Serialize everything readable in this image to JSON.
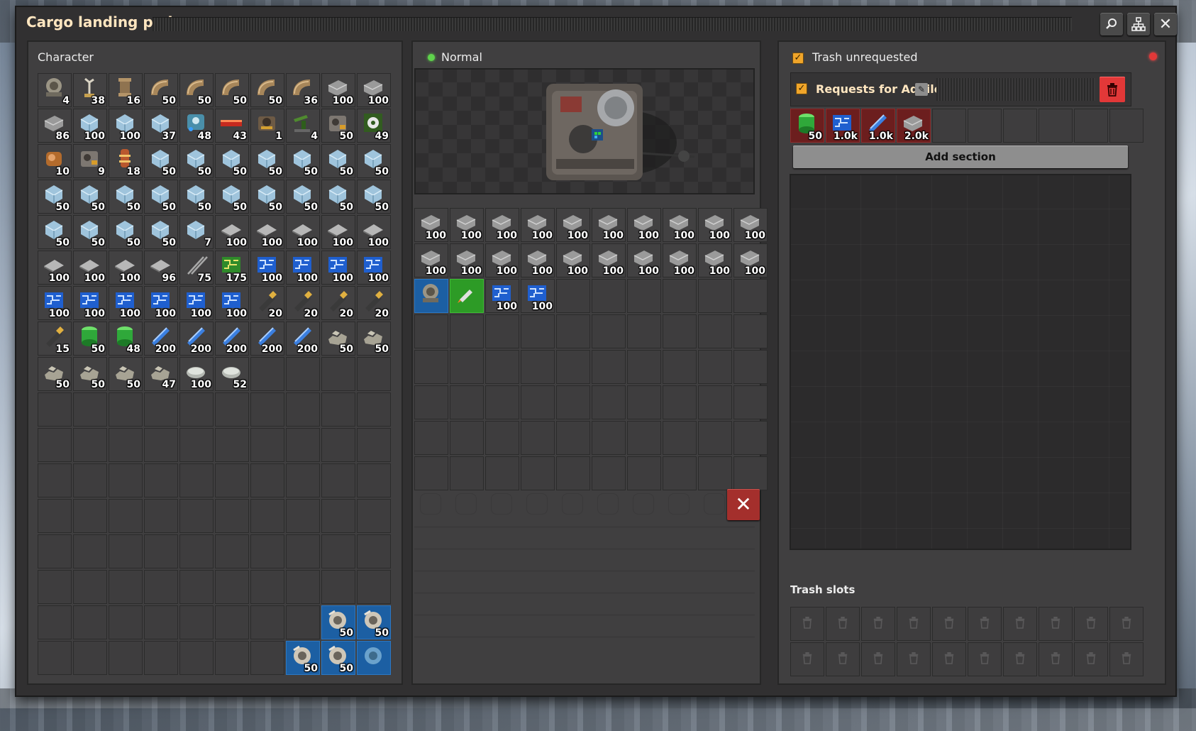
{
  "window": {
    "title": "Cargo landing pad"
  },
  "character": {
    "title": "Character",
    "slots": [
      {
        "icon": "gear-engine-icon",
        "count": "4"
      },
      {
        "icon": "inserter-icon",
        "count": "38"
      },
      {
        "icon": "pipe-icon",
        "count": "16"
      },
      {
        "icon": "pipe-elbow-icon",
        "count": "50"
      },
      {
        "icon": "pipe-elbow-icon",
        "count": "50"
      },
      {
        "icon": "pipe-elbow-icon",
        "count": "50"
      },
      {
        "icon": "pipe-elbow-icon",
        "count": "50"
      },
      {
        "icon": "pipe-elbow-icon",
        "count": "36"
      },
      {
        "icon": "steel-plate-icon",
        "count": "100"
      },
      {
        "icon": "steel-plate-icon",
        "count": "100"
      },
      {
        "icon": "steel-plate-icon",
        "count": "86"
      },
      {
        "icon": "ice-icon",
        "count": "100"
      },
      {
        "icon": "ice-icon",
        "count": "100"
      },
      {
        "icon": "ice-icon",
        "count": "37"
      },
      {
        "icon": "lab-module-icon",
        "count": "48"
      },
      {
        "icon": "red-bar-icon",
        "count": "43"
      },
      {
        "icon": "assembler-icon",
        "count": "1"
      },
      {
        "icon": "pumpjack-icon",
        "count": "4"
      },
      {
        "icon": "machine-icon",
        "count": "50"
      },
      {
        "icon": "circuit-gear-icon",
        "count": "49"
      },
      {
        "icon": "copper-machine-icon",
        "count": "10"
      },
      {
        "icon": "machine-icon",
        "count": "9"
      },
      {
        "icon": "tower-icon",
        "count": "18"
      },
      {
        "icon": "ice-icon",
        "count": "50"
      },
      {
        "icon": "ice-icon",
        "count": "50"
      },
      {
        "icon": "ice-icon",
        "count": "50"
      },
      {
        "icon": "ice-icon",
        "count": "50"
      },
      {
        "icon": "ice-icon",
        "count": "50"
      },
      {
        "icon": "ice-icon",
        "count": "50"
      },
      {
        "icon": "ice-icon",
        "count": "50"
      },
      {
        "icon": "ice-icon",
        "count": "50"
      },
      {
        "icon": "ice-icon",
        "count": "50"
      },
      {
        "icon": "ice-icon",
        "count": "50"
      },
      {
        "icon": "ice-icon",
        "count": "50"
      },
      {
        "icon": "ice-icon",
        "count": "50"
      },
      {
        "icon": "ice-icon",
        "count": "50"
      },
      {
        "icon": "ice-icon",
        "count": "50"
      },
      {
        "icon": "ice-icon",
        "count": "50"
      },
      {
        "icon": "ice-icon",
        "count": "50"
      },
      {
        "icon": "ice-icon",
        "count": "50"
      },
      {
        "icon": "ice-icon",
        "count": "50"
      },
      {
        "icon": "ice-icon",
        "count": "50"
      },
      {
        "icon": "ice-icon",
        "count": "50"
      },
      {
        "icon": "ice-icon",
        "count": "50"
      },
      {
        "icon": "ice-icon",
        "count": "7"
      },
      {
        "icon": "plate-icon",
        "count": "100"
      },
      {
        "icon": "plate-icon",
        "count": "100"
      },
      {
        "icon": "plate-icon",
        "count": "100"
      },
      {
        "icon": "plate-icon",
        "count": "100"
      },
      {
        "icon": "plate-icon",
        "count": "100"
      },
      {
        "icon": "plate-icon",
        "count": "100"
      },
      {
        "icon": "plate-icon",
        "count": "100"
      },
      {
        "icon": "plate-icon",
        "count": "100"
      },
      {
        "icon": "plate-icon",
        "count": "96"
      },
      {
        "icon": "rail-icon",
        "count": "75"
      },
      {
        "icon": "green-circuit-icon",
        "count": "175"
      },
      {
        "icon": "blue-circuit-icon",
        "count": "100"
      },
      {
        "icon": "blue-circuit-icon",
        "count": "100"
      },
      {
        "icon": "blue-circuit-icon",
        "count": "100"
      },
      {
        "icon": "blue-circuit-icon",
        "count": "100"
      },
      {
        "icon": "blue-circuit-icon",
        "count": "100"
      },
      {
        "icon": "blue-circuit-icon",
        "count": "100"
      },
      {
        "icon": "blue-circuit-icon",
        "count": "100"
      },
      {
        "icon": "blue-circuit-icon",
        "count": "100"
      },
      {
        "icon": "blue-circuit-icon",
        "count": "100"
      },
      {
        "icon": "blue-circuit-icon",
        "count": "100"
      },
      {
        "icon": "cell-icon",
        "count": "20"
      },
      {
        "icon": "cell-icon",
        "count": "20"
      },
      {
        "icon": "cell-icon",
        "count": "20"
      },
      {
        "icon": "cell-icon",
        "count": "20"
      },
      {
        "icon": "cell-icon",
        "count": "15"
      },
      {
        "icon": "green-barrel-icon",
        "count": "50"
      },
      {
        "icon": "green-barrel-icon",
        "count": "48"
      },
      {
        "icon": "blue-rod-icon",
        "count": "200"
      },
      {
        "icon": "blue-rod-icon",
        "count": "200"
      },
      {
        "icon": "blue-rod-icon",
        "count": "200"
      },
      {
        "icon": "blue-rod-icon",
        "count": "200"
      },
      {
        "icon": "blue-rod-icon",
        "count": "200"
      },
      {
        "icon": "stone-icon",
        "count": "50"
      },
      {
        "icon": "stone-icon",
        "count": "50"
      },
      {
        "icon": "stone-icon",
        "count": "50"
      },
      {
        "icon": "stone-icon",
        "count": "50"
      },
      {
        "icon": "stone-icon",
        "count": "50"
      },
      {
        "icon": "stone-icon",
        "count": "47"
      },
      {
        "icon": "disc-icon",
        "count": "100"
      },
      {
        "icon": "disc-icon",
        "count": "52"
      }
    ],
    "bottom_slots": [
      {
        "icon": "thruster-icon",
        "count": "50"
      },
      {
        "icon": "thruster-icon",
        "count": "50"
      },
      {
        "icon": "thruster-icon",
        "count": "50"
      },
      {
        "icon": "thruster-icon",
        "count": "50"
      },
      {
        "icon": "thruster-filter-icon",
        "count": ""
      }
    ]
  },
  "landing_pad": {
    "status": "Normal",
    "slots": [
      {
        "icon": "steel-plate-icon",
        "count": "100"
      },
      {
        "icon": "steel-plate-icon",
        "count": "100"
      },
      {
        "icon": "steel-plate-icon",
        "count": "100"
      },
      {
        "icon": "steel-plate-icon",
        "count": "100"
      },
      {
        "icon": "steel-plate-icon",
        "count": "100"
      },
      {
        "icon": "steel-plate-icon",
        "count": "100"
      },
      {
        "icon": "steel-plate-icon",
        "count": "100"
      },
      {
        "icon": "steel-plate-icon",
        "count": "100"
      },
      {
        "icon": "steel-plate-icon",
        "count": "100"
      },
      {
        "icon": "steel-plate-icon",
        "count": "100"
      },
      {
        "icon": "steel-plate-icon",
        "count": "100"
      },
      {
        "icon": "steel-plate-icon",
        "count": "100"
      },
      {
        "icon": "steel-plate-icon",
        "count": "100"
      },
      {
        "icon": "steel-plate-icon",
        "count": "100"
      },
      {
        "icon": "steel-plate-icon",
        "count": "100"
      },
      {
        "icon": "steel-plate-icon",
        "count": "100"
      },
      {
        "icon": "steel-plate-icon",
        "count": "100"
      },
      {
        "icon": "steel-plate-icon",
        "count": "100"
      },
      {
        "icon": "steel-plate-icon",
        "count": "100"
      },
      {
        "icon": "steel-plate-icon",
        "count": "100"
      },
      {
        "icon": "gear-engine-icon",
        "count": "",
        "style": "blue"
      },
      {
        "icon": "rocket-icon",
        "count": "",
        "style": "green"
      },
      {
        "icon": "blue-circuit-icon",
        "count": "100"
      },
      {
        "icon": "blue-circuit-icon",
        "count": "100"
      }
    ]
  },
  "logistics": {
    "trash_unrequested_label": "Trash unrequested",
    "section_title": "Requests for Aquilo",
    "requests": [
      {
        "icon": "green-barrel-icon",
        "count": "50"
      },
      {
        "icon": "blue-circuit-icon",
        "count": "1.0k"
      },
      {
        "icon": "blue-rod-icon",
        "count": "1.0k"
      },
      {
        "icon": "steel-plate-icon",
        "count": "2.0k"
      }
    ],
    "add_section_label": "Add section",
    "trash_slots_title": "Trash slots"
  },
  "colors": {
    "accent": "#f0a52a",
    "danger": "#e23838",
    "status_ok": "#5fd34c"
  }
}
